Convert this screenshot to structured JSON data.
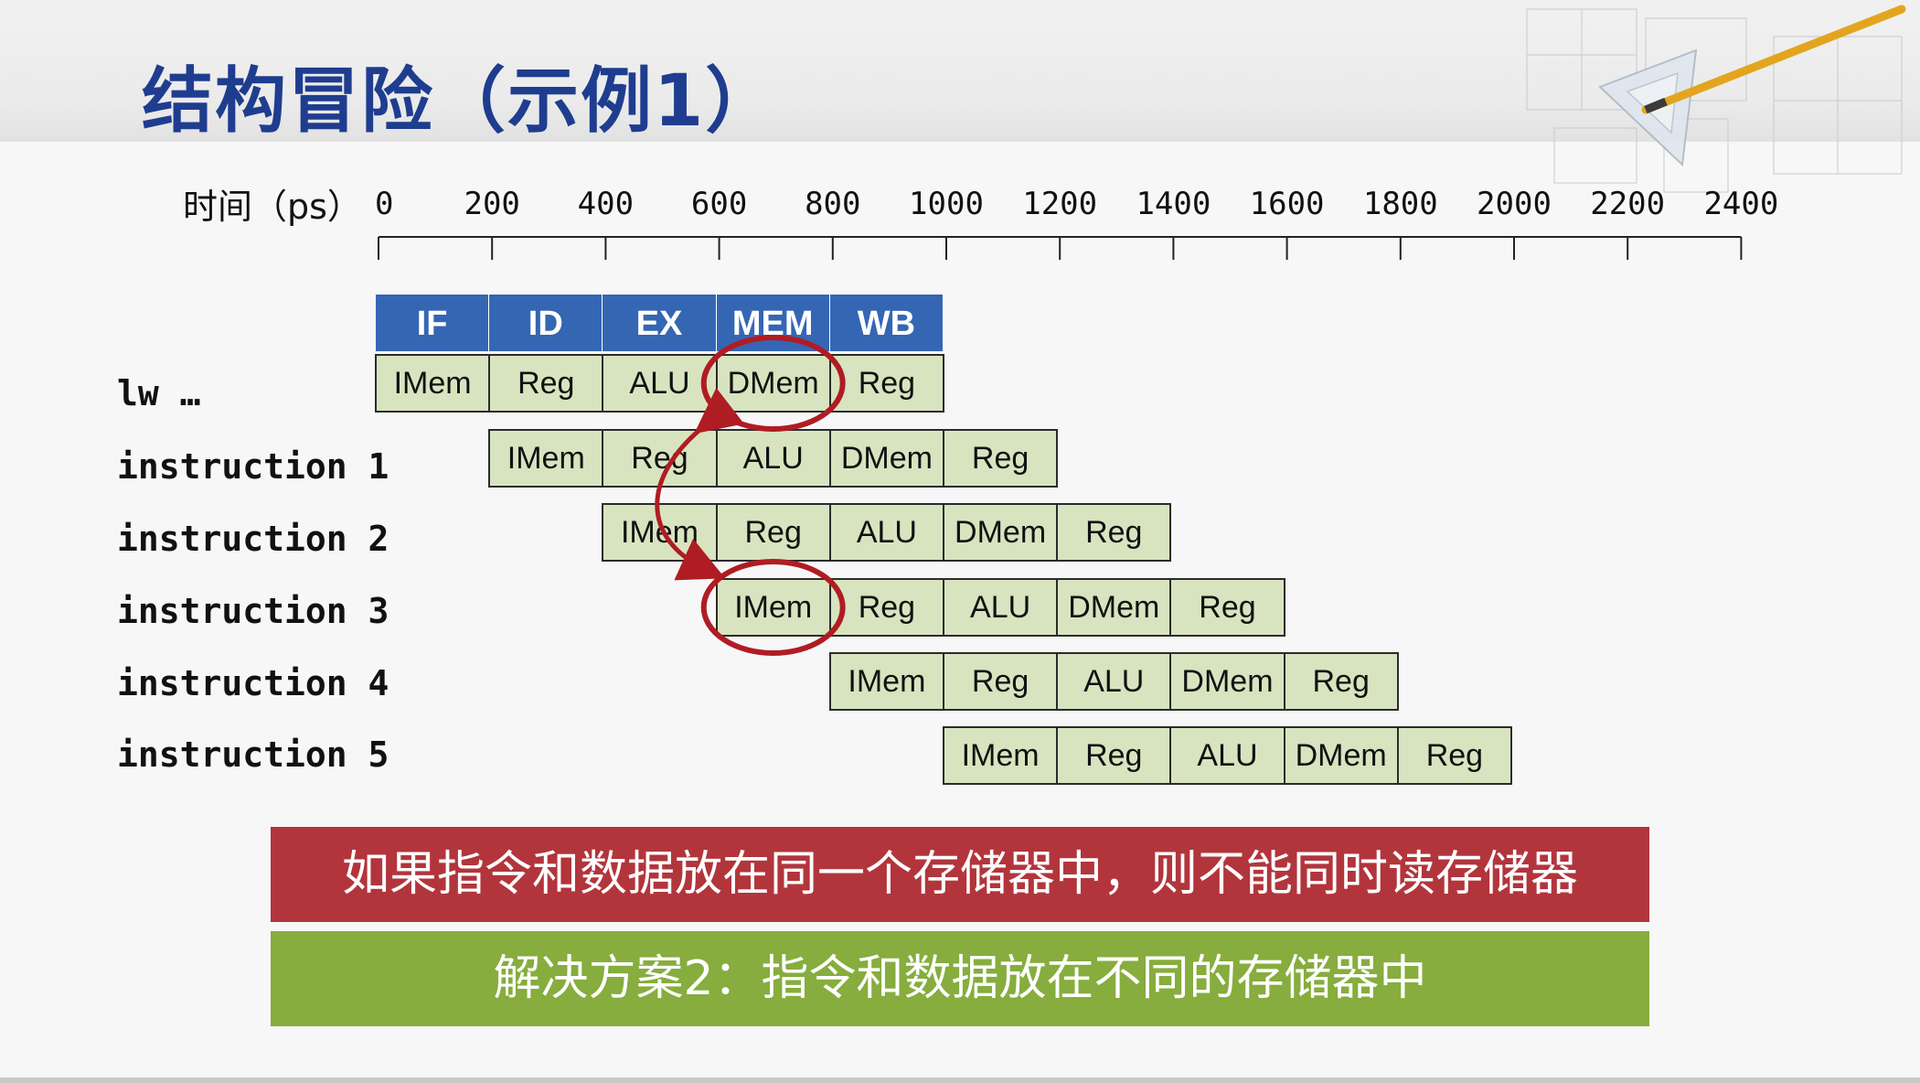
{
  "slide": {
    "title": "结构冒险（示例1）"
  },
  "timeline": {
    "label": "时间（ps）",
    "ticks": [
      "0",
      "200",
      "400",
      "600",
      "800",
      "1000",
      "1200",
      "1400",
      "1600",
      "1800",
      "2000",
      "2200",
      "2400"
    ]
  },
  "stages": [
    "IF",
    "ID",
    "EX",
    "MEM",
    "WB"
  ],
  "instructions": [
    {
      "label": "lw …",
      "cells": [
        "IMem",
        "Reg",
        "ALU",
        "DMem",
        "Reg"
      ]
    },
    {
      "label": "instruction 1",
      "cells": [
        "IMem",
        "Reg",
        "ALU",
        "DMem",
        "Reg"
      ]
    },
    {
      "label": "instruction 2",
      "cells": [
        "IMem",
        "Reg",
        "ALU",
        "DMem",
        "Reg"
      ]
    },
    {
      "label": "instruction 3",
      "cells": [
        "IMem",
        "Reg",
        "ALU",
        "DMem",
        "Reg"
      ]
    },
    {
      "label": "instruction 4",
      "cells": [
        "IMem",
        "Reg",
        "ALU",
        "DMem",
        "Reg"
      ]
    },
    {
      "label": "instruction 5",
      "cells": [
        "IMem",
        "Reg",
        "ALU",
        "DMem",
        "Reg"
      ]
    }
  ],
  "conflict": {
    "from": "lw DMem",
    "to": "instruction 3 IMem"
  },
  "banners": {
    "problem": "如果指令和数据放在同一个存储器中，则不能同时读存储器",
    "solution": "解决方案2：指令和数据放在不同的存储器中"
  },
  "colors": {
    "title": "#1f3d8f",
    "stage_header": "#3566b4",
    "cell_fill": "#d8e4bf",
    "highlight": "#b01c23",
    "problem_banner": "#b2353c",
    "solution_banner": "#86ad3d"
  }
}
